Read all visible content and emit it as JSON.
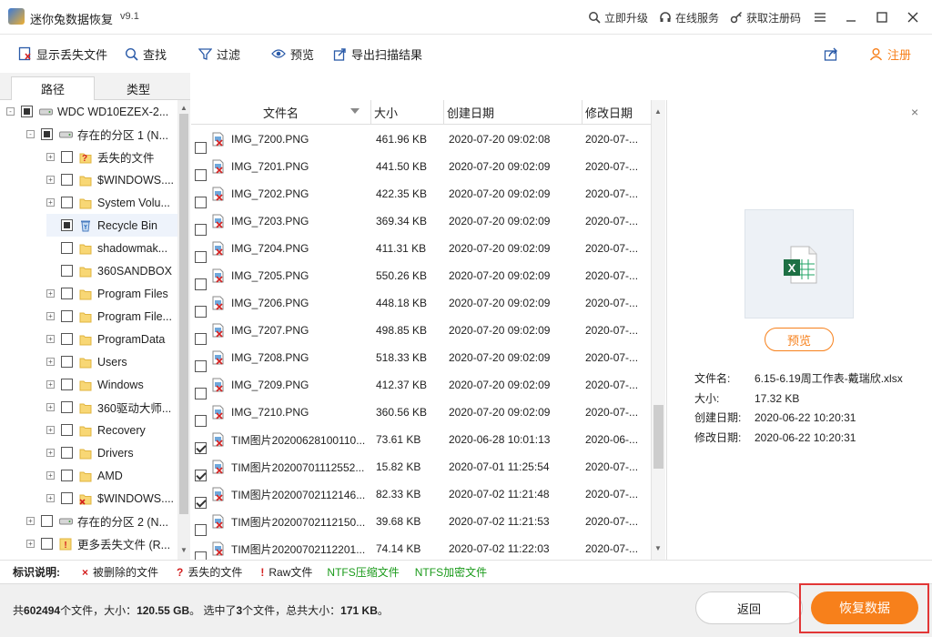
{
  "app": {
    "title": "迷你兔数据恢复",
    "version": "v9.1"
  },
  "titlebar": {
    "upgrade": "立即升级",
    "online": "在线服务",
    "register_code": "获取注册码"
  },
  "toolbar": {
    "show_lost": "显示丢失文件",
    "find": "查找",
    "filter": "过滤",
    "preview": "预览",
    "export": "导出扫描结果",
    "register": "注册"
  },
  "tabs": [
    "路径",
    "类型"
  ],
  "tree": [
    {
      "label": "WDC WD10EZEX-2...",
      "level": 0,
      "exp": "-",
      "cb": "partial",
      "icon": "drive"
    },
    {
      "label": "存在的分区 1 (N...",
      "level": 1,
      "exp": "-",
      "cb": "partial",
      "icon": "drive"
    },
    {
      "label": "丢失的文件",
      "level": 2,
      "exp": "+",
      "cb": "",
      "icon": "folder-lost"
    },
    {
      "label": "$WINDOWS....",
      "level": 2,
      "exp": "+",
      "cb": "",
      "icon": "folder"
    },
    {
      "label": "System Volu...",
      "level": 2,
      "exp": "+",
      "cb": "",
      "icon": "folder"
    },
    {
      "label": "Recycle Bin",
      "level": 2,
      "exp": "",
      "cb": "partial",
      "icon": "recycle",
      "sel": true
    },
    {
      "label": "shadowmak...",
      "level": 2,
      "exp": "",
      "cb": "",
      "icon": "folder"
    },
    {
      "label": "360SANDBOX",
      "level": 2,
      "exp": "",
      "cb": "",
      "icon": "folder"
    },
    {
      "label": "Program Files",
      "level": 2,
      "exp": "+",
      "cb": "",
      "icon": "folder"
    },
    {
      "label": "Program File...",
      "level": 2,
      "exp": "+",
      "cb": "",
      "icon": "folder"
    },
    {
      "label": "ProgramData",
      "level": 2,
      "exp": "+",
      "cb": "",
      "icon": "folder"
    },
    {
      "label": "Users",
      "level": 2,
      "exp": "+",
      "cb": "",
      "icon": "folder"
    },
    {
      "label": "Windows",
      "level": 2,
      "exp": "+",
      "cb": "",
      "icon": "folder"
    },
    {
      "label": "360驱动大师...",
      "level": 2,
      "exp": "+",
      "cb": "",
      "icon": "folder"
    },
    {
      "label": "Recovery",
      "level": 2,
      "exp": "+",
      "cb": "",
      "icon": "folder"
    },
    {
      "label": "Drivers",
      "level": 2,
      "exp": "+",
      "cb": "",
      "icon": "folder"
    },
    {
      "label": "AMD",
      "level": 2,
      "exp": "+",
      "cb": "",
      "icon": "folder"
    },
    {
      "label": "$WINDOWS....",
      "level": 2,
      "exp": "+",
      "cb": "",
      "icon": "folder-deleted"
    },
    {
      "label": "存在的分区 2 (N...",
      "level": 1,
      "exp": "+",
      "cb": "",
      "icon": "drive"
    },
    {
      "label": "更多丢失文件 (R...",
      "level": 1,
      "exp": "+",
      "cb": "",
      "icon": "lost-raw"
    }
  ],
  "columns": {
    "name": "文件名",
    "size": "大小",
    "created": "创建日期",
    "modified": "修改日期"
  },
  "files": [
    {
      "name": "IMG_7200.PNG",
      "size": "461.96 KB",
      "created": "2020-07-20 09:02:08",
      "modified": "2020-07-...",
      "checked": false
    },
    {
      "name": "IMG_7201.PNG",
      "size": "441.50 KB",
      "created": "2020-07-20 09:02:09",
      "modified": "2020-07-...",
      "checked": false
    },
    {
      "name": "IMG_7202.PNG",
      "size": "422.35 KB",
      "created": "2020-07-20 09:02:09",
      "modified": "2020-07-...",
      "checked": false
    },
    {
      "name": "IMG_7203.PNG",
      "size": "369.34 KB",
      "created": "2020-07-20 09:02:09",
      "modified": "2020-07-...",
      "checked": false
    },
    {
      "name": "IMG_7204.PNG",
      "size": "411.31 KB",
      "created": "2020-07-20 09:02:09",
      "modified": "2020-07-...",
      "checked": false
    },
    {
      "name": "IMG_7205.PNG",
      "size": "550.26 KB",
      "created": "2020-07-20 09:02:09",
      "modified": "2020-07-...",
      "checked": false
    },
    {
      "name": "IMG_7206.PNG",
      "size": "448.18 KB",
      "created": "2020-07-20 09:02:09",
      "modified": "2020-07-...",
      "checked": false
    },
    {
      "name": "IMG_7207.PNG",
      "size": "498.85 KB",
      "created": "2020-07-20 09:02:09",
      "modified": "2020-07-...",
      "checked": false
    },
    {
      "name": "IMG_7208.PNG",
      "size": "518.33 KB",
      "created": "2020-07-20 09:02:09",
      "modified": "2020-07-...",
      "checked": false
    },
    {
      "name": "IMG_7209.PNG",
      "size": "412.37 KB",
      "created": "2020-07-20 09:02:09",
      "modified": "2020-07-...",
      "checked": false
    },
    {
      "name": "IMG_7210.PNG",
      "size": "360.56 KB",
      "created": "2020-07-20 09:02:09",
      "modified": "2020-07-...",
      "checked": false
    },
    {
      "name": "TIM图片20200628100110...",
      "size": "73.61 KB",
      "created": "2020-06-28 10:01:13",
      "modified": "2020-06-...",
      "checked": true
    },
    {
      "name": "TIM图片20200701112552...",
      "size": "15.82 KB",
      "created": "2020-07-01 11:25:54",
      "modified": "2020-07-...",
      "checked": true
    },
    {
      "name": "TIM图片20200702112146...",
      "size": "82.33 KB",
      "created": "2020-07-02 11:21:48",
      "modified": "2020-07-...",
      "checked": true
    },
    {
      "name": "TIM图片20200702112150...",
      "size": "39.68 KB",
      "created": "2020-07-02 11:21:53",
      "modified": "2020-07-...",
      "checked": false
    },
    {
      "name": "TIM图片20200702112201...",
      "size": "74.14 KB",
      "created": "2020-07-02 11:22:03",
      "modified": "2020-07-...",
      "checked": false
    }
  ],
  "preview": {
    "button": "预览",
    "labels": {
      "name": "文件名:",
      "size": "大小:",
      "created": "创建日期:",
      "modified": "修改日期:"
    },
    "values": {
      "name": "6.15-6.19周工作表-戴瑞欣.xlsx",
      "size": "17.32 KB",
      "created": "2020-06-22 10:20:31",
      "modified": "2020-06-22 10:20:31"
    }
  },
  "legend": {
    "title": "标识说明:",
    "deleted_mark": "×",
    "deleted": "被删除的文件",
    "lost_mark": "?",
    "lost": "丢失的文件",
    "raw_mark": "!",
    "raw": "Raw文件",
    "ntfs_compressed": "NTFS压缩文件",
    "ntfs_encrypted": "NTFS加密文件"
  },
  "status": {
    "total_prefix": "共",
    "total_count": "602494",
    "total_mid": "个文件，大小：",
    "total_size": "120.55 GB",
    "sel_prefix": "。 选中了",
    "sel_count": "3",
    "sel_mid": "个文件，总共大小：",
    "sel_size": "171 KB",
    "sel_suffix": "。"
  },
  "buttons": {
    "back": "返回",
    "recover": "恢复数据"
  },
  "colors": {
    "accent": "#f7801b",
    "highlight": "#e23636",
    "green": "#1a9a1a",
    "red": "#d42020"
  }
}
